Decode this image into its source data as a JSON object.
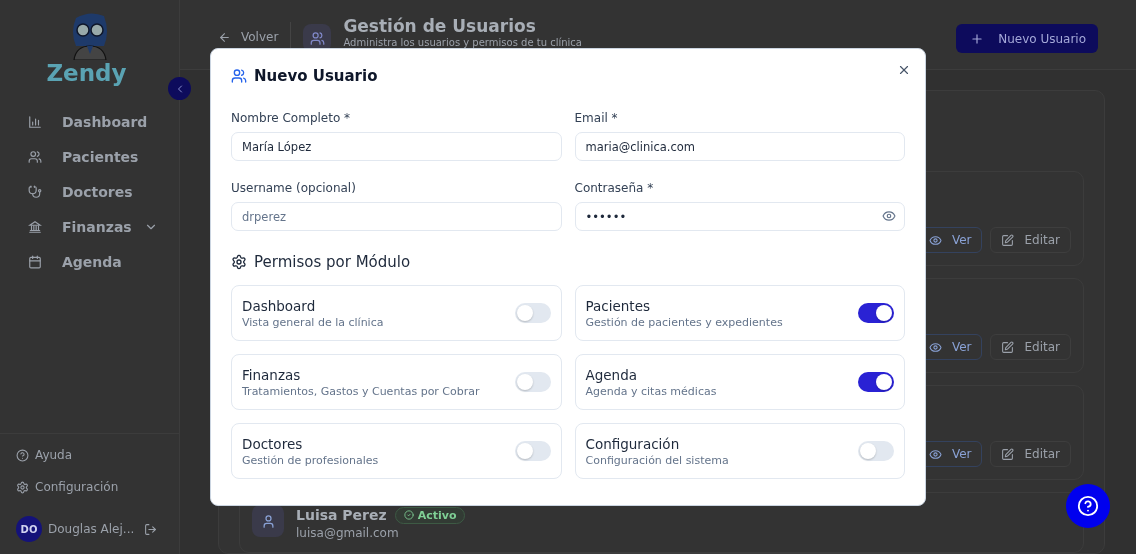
{
  "sidebar": {
    "brand": "Zendy",
    "nav": [
      {
        "label": "Dashboard",
        "expandable": false
      },
      {
        "label": "Pacientes",
        "expandable": false
      },
      {
        "label": "Doctores",
        "expandable": false
      },
      {
        "label": "Finanzas",
        "expandable": true
      },
      {
        "label": "Agenda",
        "expandable": false
      }
    ],
    "footer": [
      {
        "label": "Ayuda"
      },
      {
        "label": "Configuración"
      }
    ],
    "user": {
      "initials": "DO",
      "name": "Douglas Alej..."
    }
  },
  "header": {
    "back": "Volver",
    "title": "Gestión de Usuarios",
    "subtitle": "Administra los usuarios y permisos de tu clínica",
    "new_button": "Nuevo Usuario"
  },
  "user_cards": [
    {
      "view": "Ver",
      "edit": "Editar"
    },
    {
      "view": "Ver",
      "edit": "Editar"
    },
    {
      "view": "Ver",
      "edit": "Editar"
    }
  ],
  "last_user": {
    "name": "Luisa Perez",
    "status": "Activo",
    "email": "luisa@gmail.com"
  },
  "dialog": {
    "title": "Nuevo Usuario",
    "fields": [
      {
        "label": "Nombre Completo *",
        "value": "María López",
        "kind": "text"
      },
      {
        "label": "Email *",
        "value": "maria@clinica.com",
        "kind": "text"
      },
      {
        "label": "Username (opcional)",
        "placeholder": "drperez",
        "kind": "text"
      },
      {
        "label": "Contraseña *",
        "value": "••••••",
        "kind": "password"
      }
    ],
    "permissions_title": "Permisos por Módulo",
    "permissions": [
      {
        "name": "Dashboard",
        "description": "Vista general de la clínica",
        "on": false
      },
      {
        "name": "Pacientes",
        "description": "Gestión de pacientes y expedientes",
        "on": true
      },
      {
        "name": "Finanzas",
        "description": "Tratamientos, Gastos y Cuentas por Cobrar",
        "on": false
      },
      {
        "name": "Agenda",
        "description": "Agenda y citas médicas",
        "on": true
      },
      {
        "name": "Doctores",
        "description": "Gestión de profesionales",
        "on": false
      },
      {
        "name": "Configuración",
        "description": "Configuración del sistema",
        "on": false
      }
    ]
  }
}
